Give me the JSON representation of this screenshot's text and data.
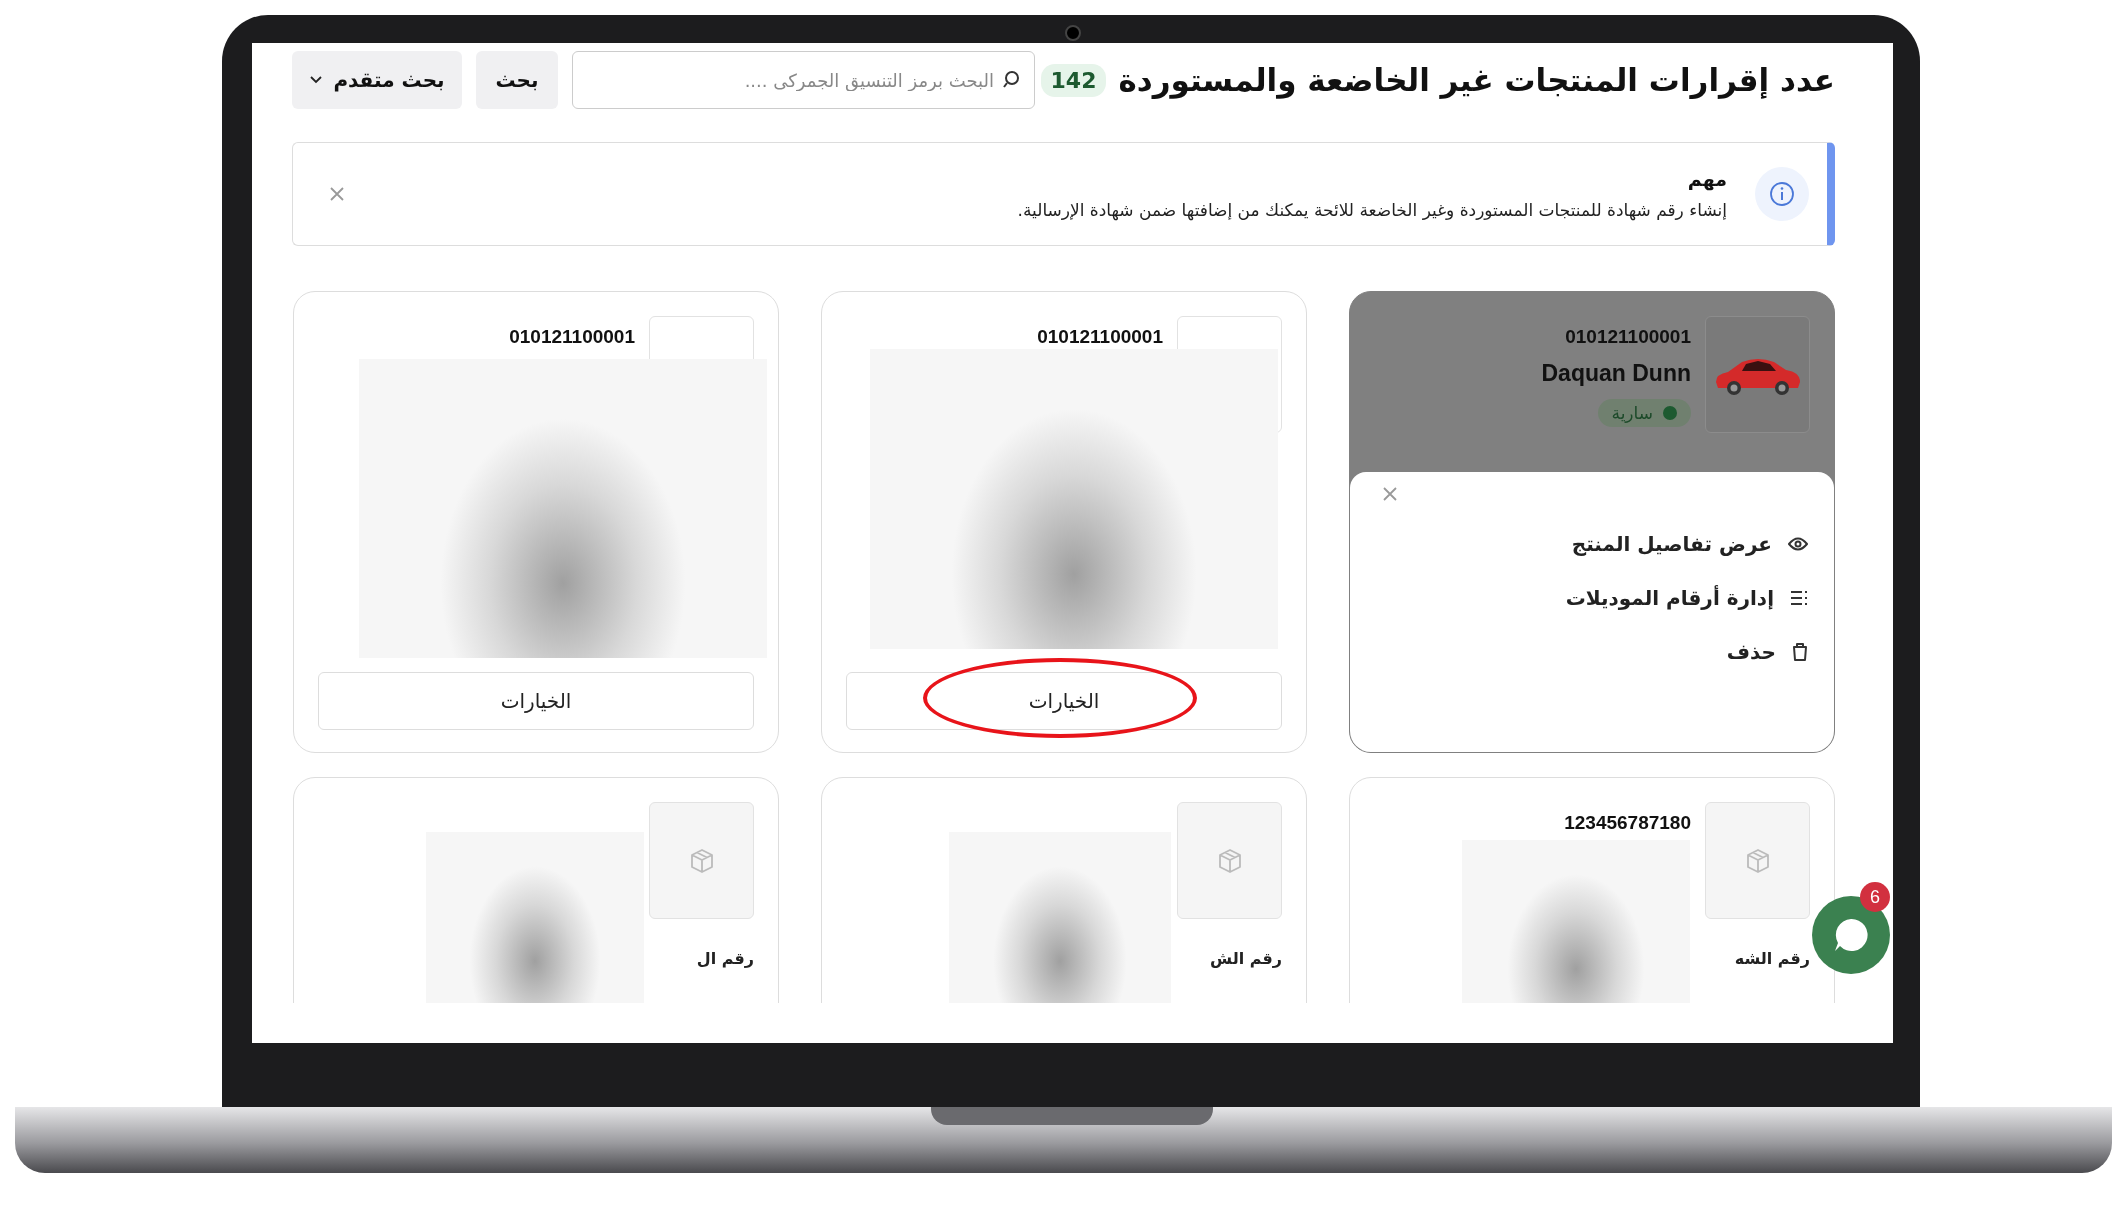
{
  "header": {
    "title": "عدد إقرارات المنتجات غير الخاضعة والمستوردة",
    "count": "142",
    "search": {
      "placeholder": "البحث برمز التنسيق الجمركى ...."
    },
    "search_button": "بحث",
    "advanced_button": "بحث متقدم"
  },
  "notice": {
    "title": "مهم",
    "text": "إنشاء رقم شهادة للمنتجات المستوردة وغير الخاضعة للائحة يمكنك من إضافتها ضمن شهادة الإرسالية."
  },
  "cards": [
    {
      "kind": "menu-open",
      "number": "010121100001",
      "name": "Daquan Dunn",
      "status": {
        "label": "سارية",
        "color": "#1d5a30"
      },
      "menu": [
        {
          "kind": "view",
          "label": "عرض تفاصيل المنتج"
        },
        {
          "kind": "list",
          "label": "إدارة أرقام الموديلات"
        },
        {
          "kind": "delete",
          "label": "حذف"
        }
      ]
    },
    {
      "kind": "redacted",
      "number": "010121100001",
      "button": "الخيارات",
      "highlighted": true
    },
    {
      "kind": "redacted",
      "number": "010121100001",
      "button": "الخيارات",
      "highlighted": false
    },
    {
      "kind": "redacted-cut",
      "number": "123456787180",
      "label": "رقم الشه"
    },
    {
      "kind": "redacted-cut",
      "label": "رقم الش"
    },
    {
      "kind": "redacted-cut",
      "label": "رقم ال"
    }
  ],
  "chat": {
    "badge": "6"
  }
}
